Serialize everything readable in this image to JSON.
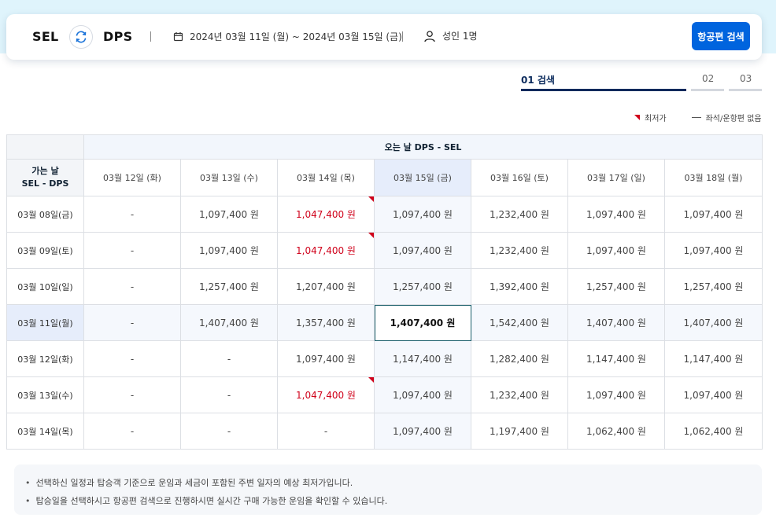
{
  "header": {
    "origin": "SEL",
    "destination": "DPS",
    "date_range": "2024년 03월 11일 (월) ~ 2024년 03월 15일 (금)",
    "passengers": "성인 1명",
    "search_button": "항공편 검색",
    "icons": {
      "swap": "swap-icon",
      "calendar": "calendar-icon",
      "person": "person-icon"
    }
  },
  "steps": [
    {
      "label": "01  검색",
      "active": true
    },
    {
      "label": "02",
      "active": false
    },
    {
      "label": "03",
      "active": false
    }
  ],
  "legend": {
    "lowest": "최저가",
    "unavailable": "좌석/운항편 없음"
  },
  "grid": {
    "return_header": "오는 날 DPS - SEL",
    "depart_header_line1": "가는 날",
    "depart_header_line2": "SEL - DPS",
    "return_dates": [
      "03월 12일 (화)",
      "03월 13일 (수)",
      "03월 14일 (목)",
      "03월 15일 (금)",
      "03월 16일 (토)",
      "03월 17일 (일)",
      "03월 18일 (월)"
    ],
    "selected_return_index": 3,
    "selected_depart_index": 3,
    "rows": [
      {
        "date": "03월 08일(금)",
        "prices": [
          "-",
          "1,097,400 원",
          "1,047,400 원",
          "1,097,400 원",
          "1,232,400 원",
          "1,097,400 원",
          "1,097,400 원"
        ],
        "lowest": [
          2
        ]
      },
      {
        "date": "03월 09일(토)",
        "prices": [
          "-",
          "1,097,400 원",
          "1,047,400 원",
          "1,097,400 원",
          "1,232,400 원",
          "1,097,400 원",
          "1,097,400 원"
        ],
        "lowest": [
          2
        ]
      },
      {
        "date": "03월 10일(일)",
        "prices": [
          "-",
          "1,257,400 원",
          "1,207,400 원",
          "1,257,400 원",
          "1,392,400 원",
          "1,257,400 원",
          "1,257,400 원"
        ],
        "lowest": []
      },
      {
        "date": "03월 11일(월)",
        "prices": [
          "-",
          "1,407,400 원",
          "1,357,400 원",
          "1,407,400 원",
          "1,542,400 원",
          "1,407,400 원",
          "1,407,400 원"
        ],
        "lowest": []
      },
      {
        "date": "03월 12일(화)",
        "prices": [
          "-",
          "-",
          "1,097,400 원",
          "1,147,400 원",
          "1,282,400 원",
          "1,147,400 원",
          "1,147,400 원"
        ],
        "lowest": []
      },
      {
        "date": "03월 13일(수)",
        "prices": [
          "-",
          "-",
          "1,047,400 원",
          "1,097,400 원",
          "1,232,400 원",
          "1,097,400 원",
          "1,097,400 원"
        ],
        "lowest": [
          2
        ]
      },
      {
        "date": "03월 14일(목)",
        "prices": [
          "-",
          "-",
          "-",
          "1,097,400 원",
          "1,197,400 원",
          "1,062,400 원",
          "1,062,400 원"
        ],
        "lowest": []
      }
    ]
  },
  "notes": [
    "선택하신 일정과 탑승객 기준으로 운임과 세금이 포함된 주변 일자의 예상 최저가입니다.",
    "탑승일을 선택하시고 항공편 검색으로 진행하시면 실시간 구매 가능한 운임을 확인할 수 있습니다."
  ],
  "colors": {
    "accent": "#0064de",
    "lowest": "#d0021b",
    "highlight": "#e6edfb",
    "navy": "#0a2a5c"
  }
}
